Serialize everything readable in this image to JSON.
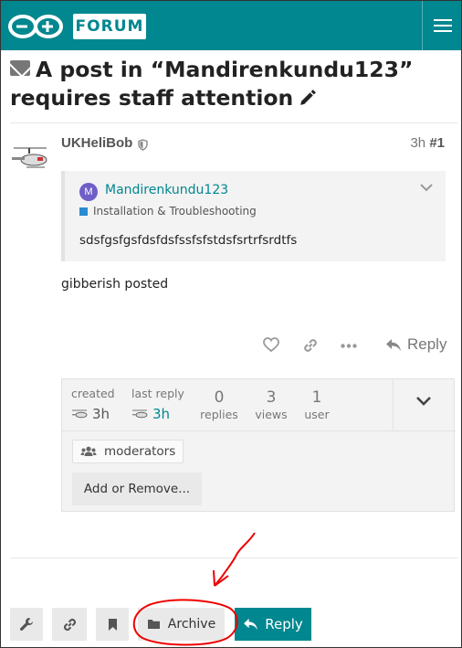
{
  "header": {
    "logo_text": "FORUM",
    "menu_icon": "hamburger-icon",
    "accent_color": "#00878f"
  },
  "topic": {
    "title": "A post in “Mandirenkundu123” requires staff attention"
  },
  "post": {
    "username": "UKHeliBob",
    "age": "3h",
    "number": "#1",
    "quote": {
      "avatar_letter": "M",
      "username": "Mandirenkundu123",
      "category": "Installation & Troubleshooting",
      "body": "sdsfgsfgsfdsfdsfssfsfstdsfsrtrfsrdtfs"
    },
    "text": "gibberish posted",
    "reply_label": "Reply"
  },
  "topic_map": {
    "created_label": "created",
    "created_value": "3h",
    "last_reply_label": "last reply",
    "last_reply_value": "3h",
    "replies_count": "0",
    "replies_label": "replies",
    "views_count": "3",
    "views_label": "views",
    "users_count": "1",
    "users_label": "user",
    "group_name": "moderators",
    "add_remove_label": "Add or Remove..."
  },
  "footer": {
    "archive_label": "Archive",
    "reply_label": "Reply"
  }
}
